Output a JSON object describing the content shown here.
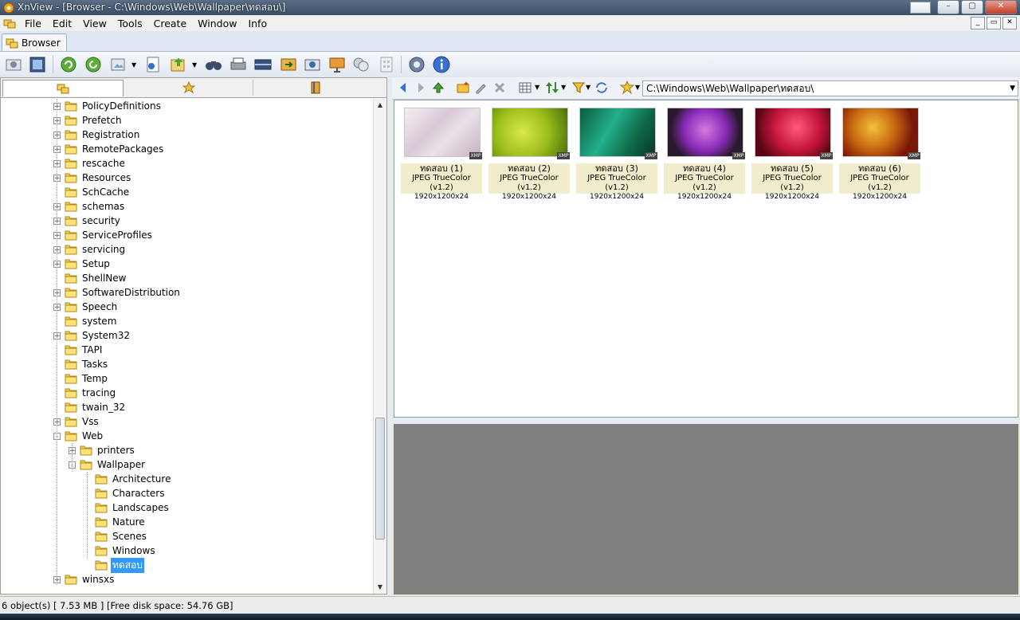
{
  "window": {
    "title": "XnView - [Browser - C:\\Windows\\Web\\Wallpaper\\ทดสอบ\\]"
  },
  "menu": [
    "File",
    "Edit",
    "View",
    "Tools",
    "Create",
    "Window",
    "Info"
  ],
  "tabs": {
    "browser": "Browser"
  },
  "address": {
    "path": "C:\\Windows\\Web\\Wallpaper\\ทดสอบ\\"
  },
  "tree": [
    {
      "label": "PolicyDefinitions",
      "expander": "+"
    },
    {
      "label": "Prefetch",
      "expander": "+"
    },
    {
      "label": "Registration",
      "expander": "+"
    },
    {
      "label": "RemotePackages",
      "expander": "+"
    },
    {
      "label": "rescache",
      "expander": "+"
    },
    {
      "label": "Resources",
      "expander": "+"
    },
    {
      "label": "SchCache",
      "expander": ""
    },
    {
      "label": "schemas",
      "expander": "+"
    },
    {
      "label": "security",
      "expander": "+"
    },
    {
      "label": "ServiceProfiles",
      "expander": "+"
    },
    {
      "label": "servicing",
      "expander": "+"
    },
    {
      "label": "Setup",
      "expander": "+"
    },
    {
      "label": "ShellNew",
      "expander": ""
    },
    {
      "label": "SoftwareDistribution",
      "expander": "+"
    },
    {
      "label": "Speech",
      "expander": "+"
    },
    {
      "label": "system",
      "expander": ""
    },
    {
      "label": "System32",
      "expander": "+"
    },
    {
      "label": "TAPI",
      "expander": ""
    },
    {
      "label": "Tasks",
      "expander": ""
    },
    {
      "label": "Temp",
      "expander": ""
    },
    {
      "label": "tracing",
      "expander": ""
    },
    {
      "label": "twain_32",
      "expander": ""
    },
    {
      "label": "Vss",
      "expander": "+"
    },
    {
      "label": "Web",
      "expander": "-"
    },
    {
      "label": "printers",
      "expander": "+"
    },
    {
      "label": "Wallpaper",
      "expander": "-"
    },
    {
      "label": "Architecture",
      "expander": ""
    },
    {
      "label": "Characters",
      "expander": ""
    },
    {
      "label": "Landscapes",
      "expander": ""
    },
    {
      "label": "Nature",
      "expander": ""
    },
    {
      "label": "Scenes",
      "expander": ""
    },
    {
      "label": "Windows",
      "expander": ""
    },
    {
      "label": "ทดสอบ",
      "expander": ""
    },
    {
      "label": "winsxs",
      "expander": "+"
    }
  ],
  "thumbnails": [
    {
      "name": "ทดสอบ (1)",
      "type": "JPEG TrueColor (v1.2)",
      "dims": "1920x1200x24",
      "badge": "XMP"
    },
    {
      "name": "ทดสอบ (2)",
      "type": "JPEG TrueColor (v1.2)",
      "dims": "1920x1200x24",
      "badge": "XMP"
    },
    {
      "name": "ทดสอบ (3)",
      "type": "JPEG TrueColor (v1.2)",
      "dims": "1920x1200x24",
      "badge": "XMP"
    },
    {
      "name": "ทดสอบ (4)",
      "type": "JPEG TrueColor (v1.2)",
      "dims": "1920x1200x24",
      "badge": "XMP"
    },
    {
      "name": "ทดสอบ (5)",
      "type": "JPEG TrueColor (v1.2)",
      "dims": "1920x1200x24",
      "badge": "XMP"
    },
    {
      "name": "ทดสอบ (6)",
      "type": "JPEG TrueColor (v1.2)",
      "dims": "1920x1200x24",
      "badge": "XMP"
    }
  ],
  "status": {
    "text": "6 object(s) [ 7.53 MB ] [Free disk space: 54.76 GB]"
  },
  "colors": {
    "selection": "#3399ff",
    "preview_bg": "#7f7f7f",
    "caption_bg": "#f0eccc"
  }
}
